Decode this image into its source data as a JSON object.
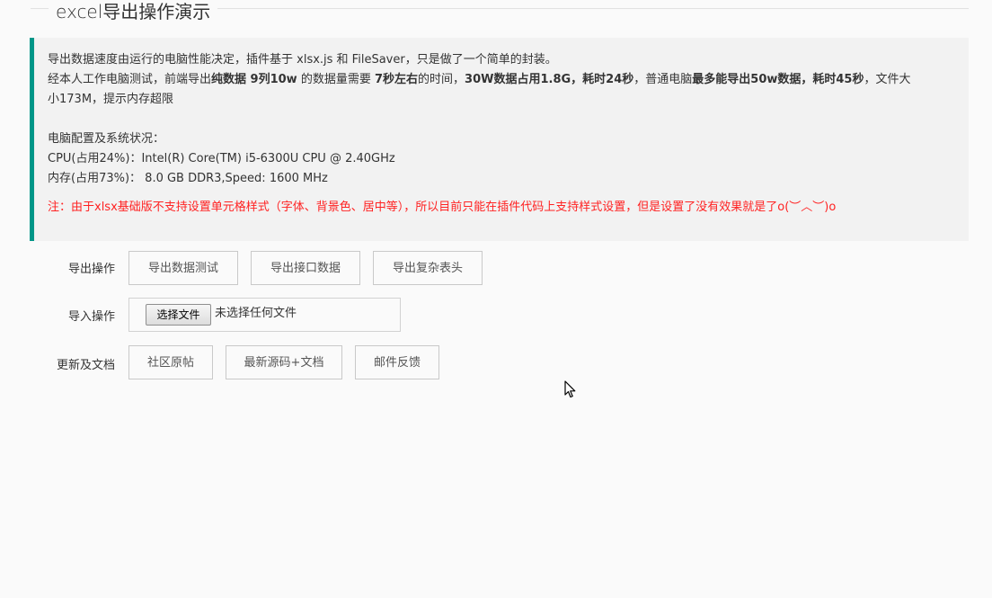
{
  "header": {
    "title": "excel导出操作演示"
  },
  "intro": {
    "line1": "导出数据速度由运行的电脑性能决定，插件基于 xlsx.js 和 FileSaver，只是做了一个简单的封装。",
    "line2_a": "经本人工作电脑测试，前端导出",
    "line2_b": "纯数据 9列10w",
    "line2_c": " 的数据量需要 ",
    "line2_d": "7秒左右",
    "line2_e": "的时间，",
    "line2_f": "30W数据占用1.8G，耗时24秒",
    "line2_g": "，普通电脑",
    "line2_h": "最多能导出50w数据，耗时45秒",
    "line2_i": "，文件大",
    "line3": "小173M，提示内存超限",
    "config_title": "电脑配置及系统状况：",
    "cpu": "CPU(占用24%)：Intel(R) Core(TM) i5-6300U CPU @ 2.40GHz",
    "memory": "内存(占用73%)： 8.0 GB DDR3,Speed: 1600 MHz",
    "note": "注：由于xlsx基础版不支持设置单元格样式（字体、背景色、居中等），所以目前只能在插件代码上支持样式设置，但是设置了没有效果就是了o(︶︿︶)o"
  },
  "export": {
    "label": "导出操作",
    "buttons": [
      "导出数据测试",
      "导出接口数据",
      "导出复杂表头"
    ]
  },
  "import": {
    "label": "导入操作",
    "file_button": "选择文件",
    "file_status": "未选择任何文件"
  },
  "docs": {
    "label": "更新及文档",
    "buttons": [
      "社区原帖",
      "最新源码+文档",
      "邮件反馈"
    ]
  },
  "colors": {
    "accent": "#009688",
    "note": "#ff2222"
  }
}
